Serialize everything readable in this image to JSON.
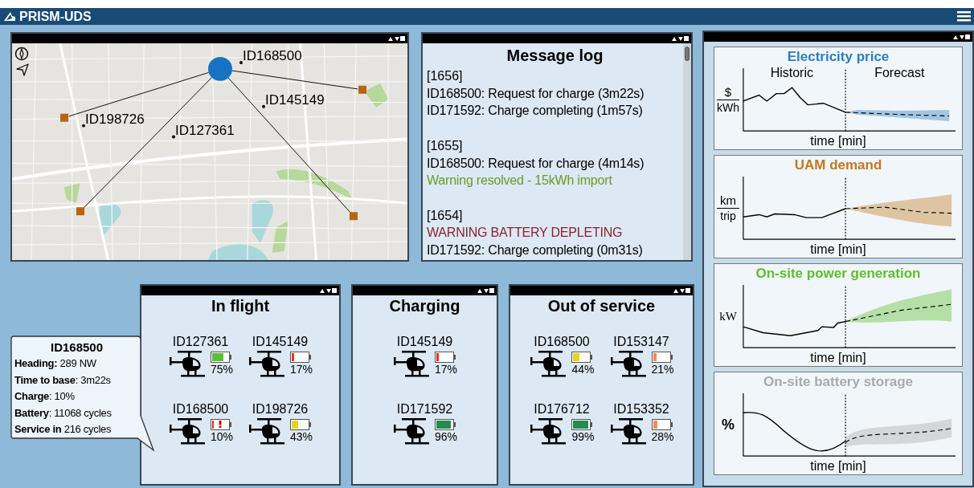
{
  "app": {
    "title": "PRISM-UDS"
  },
  "map": {
    "aircraft": [
      {
        "label": "ID168500"
      },
      {
        "label": "ID145149"
      },
      {
        "label": "ID198726"
      },
      {
        "label": "ID127361"
      }
    ]
  },
  "message_log": {
    "title": "Message log",
    "groups": [
      {
        "time": "[1656]",
        "lines": [
          {
            "kind": "info",
            "text": "ID168500: Request for charge (3m22s)"
          },
          {
            "kind": "info",
            "text": "ID171592: Charge completing (1m57s)"
          }
        ]
      },
      {
        "time": "[1655]",
        "lines": [
          {
            "kind": "info",
            "text": "ID168500: Request for charge (4m14s)"
          },
          {
            "kind": "resolved",
            "text": "Warning resolved - 15kWh import"
          }
        ]
      },
      {
        "time": "[1654]",
        "lines": [
          {
            "kind": "warning",
            "text": "WARNING BATTERY DEPLETING"
          },
          {
            "kind": "info",
            "text": "ID171592: Charge completing (0m31s)"
          }
        ]
      }
    ]
  },
  "charts": [
    {
      "title": "Electricity price",
      "color": "#2a7fc0",
      "ylabel": {
        "kind": "fraction",
        "top": "$",
        "bottom": "kWh"
      },
      "xlabel": "time [min]",
      "segments": [
        "Historic",
        "Forecast"
      ]
    },
    {
      "title": "UAM demand",
      "color": "#c07a20",
      "ylabel": {
        "kind": "fraction",
        "top": "km",
        "bottom": "trip"
      },
      "xlabel": "time [min]"
    },
    {
      "title": "On-site power generation",
      "color": "#5cbf2a",
      "ylabel": {
        "kind": "serif",
        "text": "kW"
      },
      "xlabel": "time [min]"
    },
    {
      "title": "On-site battery storage",
      "color": "#aaaaaa",
      "ylabel": {
        "kind": "bold",
        "text": "%"
      },
      "xlabel": "time [min]"
    }
  ],
  "fleet": [
    {
      "title": "In flight",
      "aircraft": [
        {
          "id": "ID127361",
          "percent": "75%",
          "color": "#5cbf3a",
          "alert": false
        },
        {
          "id": "ID145149",
          "percent": "17%",
          "color": "#e8321e",
          "alert": false
        },
        {
          "id": "ID168500",
          "percent": "10%",
          "color": "#e8321e",
          "alert": true
        },
        {
          "id": "ID198726",
          "percent": "43%",
          "color": "#e8d41e",
          "alert": false
        }
      ]
    },
    {
      "title": "Charging",
      "aircraft": [
        {
          "id": "ID145149",
          "percent": "17%",
          "color": "#e8321e",
          "alert": false
        },
        {
          "id": "ID171592",
          "percent": "96%",
          "color": "#228b4e",
          "alert": false
        }
      ]
    },
    {
      "title": "Out of service",
      "aircraft": [
        {
          "id": "ID168500",
          "percent": "44%",
          "color": "#e8d41e",
          "alert": false
        },
        {
          "id": "ID153147",
          "percent": "21%",
          "color": "#f58a52",
          "alert": false
        },
        {
          "id": "ID176712",
          "percent": "99%",
          "color": "#228b4e",
          "alert": false
        },
        {
          "id": "ID153352",
          "percent": "28%",
          "color": "#f58a52",
          "alert": false
        }
      ]
    }
  ],
  "tooltip": {
    "title": "ID168500",
    "lines": [
      "**Heading:** 289 NW",
      "**Time to base**: 3m22s",
      "**Charge**: 10%",
      "**Battery**: 11068 cycles",
      "**Service in** 216 cycles"
    ]
  }
}
